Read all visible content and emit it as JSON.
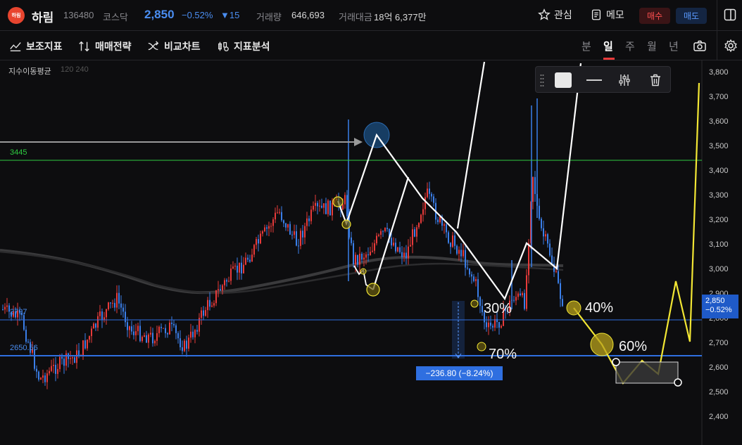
{
  "header": {
    "logo_text": "하림",
    "name": "하림",
    "code": "136480",
    "market": "코스닥",
    "price": "2,850",
    "change_pct": "−0.52%",
    "change_abs": "▼15",
    "volume_label": "거래량",
    "volume_value": "646,693",
    "amount_label": "거래대금",
    "amount_value": "18억 6,377만",
    "watch_label": "관심",
    "memo_label": "메모",
    "buy_label": "매수",
    "sell_label": "매도"
  },
  "toolbar": {
    "tools": [
      "보조지표",
      "매매전략",
      "비교차트",
      "지표분석"
    ],
    "periods": [
      "분",
      "일",
      "주",
      "월",
      "년"
    ],
    "active_period": "일"
  },
  "chart": {
    "indicator_label": "지수이동평균",
    "indicator_params": "120 240",
    "y_axis_ticks": [
      "3,800",
      "3,700",
      "3,600",
      "3,500",
      "3,400",
      "3,300",
      "3,200",
      "3,100",
      "3,000",
      "2,900",
      "2,800",
      "2,700",
      "2,600",
      "2,500",
      "2,400"
    ],
    "last_price": "2,850",
    "last_change": "−0.52%",
    "hline_green_label": "3445",
    "hline_blue1_label": "2797",
    "hline_blue2_label": "2650.56",
    "measure_label": "−236.80 (−8.24%)",
    "pct_30": "30%",
    "pct_70": "70%",
    "pct_40": "40%",
    "pct_60": "60%"
  },
  "colors": {
    "bg": "#0d0d0f",
    "up": "#e83a3a",
    "down": "#3a7ee8",
    "green_line": "#2ecc40",
    "blue_line": "#2f6fe0",
    "yellow": "#f2e634"
  }
}
